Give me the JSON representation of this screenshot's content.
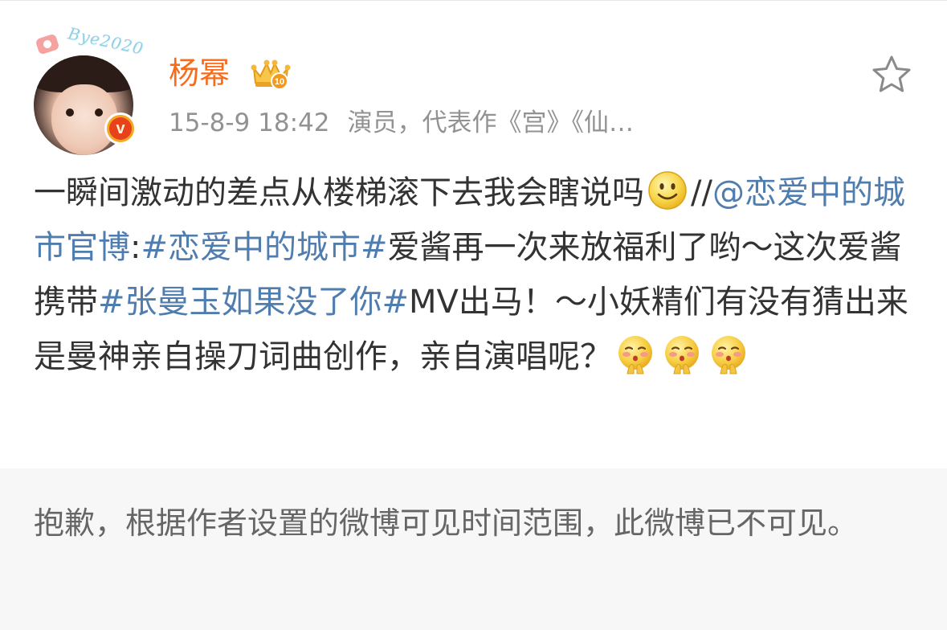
{
  "post": {
    "author": {
      "name": "杨幂",
      "avatar_badge_text": "Bye2020",
      "verified_icon": "verified-v-icon",
      "vip_icon": "vip-crown-icon"
    },
    "time": "15-8-9 18:42",
    "bio": "演员，代表作《宫》《仙…",
    "favorite_icon": "star-outline-icon",
    "content": {
      "part1": "一瞬间激动的差点从楼梯滚下去我会瞎说吗",
      "part2": "//",
      "mention": "@恋爱中的城市官博",
      "part3": ":",
      "hashtag1": "#恋爱中的城市#",
      "part4": "爱酱再一次来放福利了哟～这次爱酱携带",
      "hashtag2": "#张曼玉如果没了你#",
      "part5": "MV出马！～小妖精们有没有猜出来是曼神亲自操刀词曲创作，亲自演唱呢？",
      "emoji_smile": "smile-emoji-icon",
      "emoji_shy": "shy-emoji-icon"
    }
  },
  "notice": {
    "text": "抱歉，根据作者设置的微博可见时间范围，此微博已不可见。"
  },
  "colors": {
    "username": "#f86b1a",
    "link": "#507daf",
    "meta": "#929292",
    "body_text": "#333333",
    "notice_bg": "#f7f7f7"
  }
}
